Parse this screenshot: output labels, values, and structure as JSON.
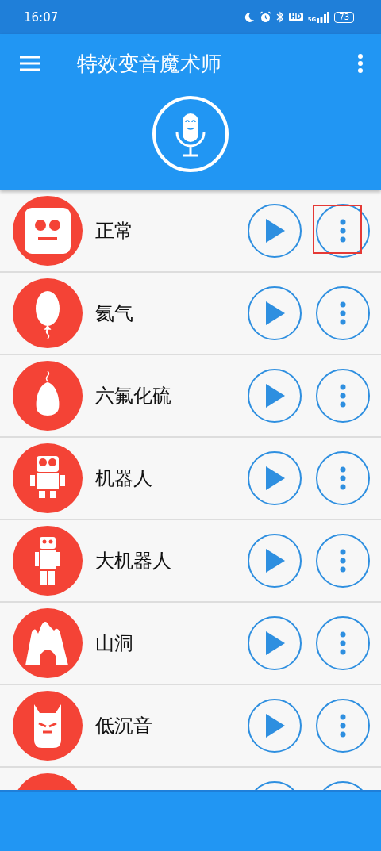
{
  "status_bar": {
    "time": "16:07",
    "hd": "HD",
    "network": "5G",
    "battery": "73"
  },
  "app_bar": {
    "title": "特效变音魔术师"
  },
  "effects": [
    {
      "label": "正常",
      "kind": "face",
      "menu_highlighted": true
    },
    {
      "label": "氦气",
      "kind": "balloon",
      "menu_highlighted": false
    },
    {
      "label": "六氟化硫",
      "kind": "sack",
      "menu_highlighted": false
    },
    {
      "label": "机器人",
      "kind": "robot",
      "menu_highlighted": false
    },
    {
      "label": "大机器人",
      "kind": "giant",
      "menu_highlighted": false
    },
    {
      "label": "山洞",
      "kind": "cave",
      "menu_highlighted": false
    },
    {
      "label": "低沉音",
      "kind": "mask",
      "menu_highlighted": false
    },
    {
      "kind": "hidden",
      "menu_highlighted": false
    }
  ]
}
